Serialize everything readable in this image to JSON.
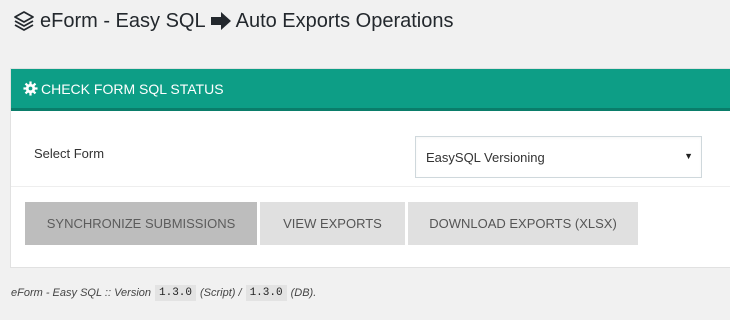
{
  "header": {
    "title_part1": "eForm - Easy SQL",
    "title_part2": "Auto Exports Operations",
    "icons": [
      "layers-icon",
      "arrow-right-icon"
    ]
  },
  "panel": {
    "heading": "CHECK FORM SQL STATUS",
    "heading_icon": "gear-icon",
    "heading_color": "#0d9e86",
    "form": {
      "label": "Select Form",
      "selected_value": "EasySQL Versioning"
    },
    "buttons": {
      "sync": "SYNCHRONIZE SUBMISSIONS",
      "view": "VIEW EXPORTS",
      "download": "DOWNLOAD EXPORTS (XLSX)"
    }
  },
  "footer": {
    "prefix": "eForm - Easy SQL :: Version",
    "script_version": "1.3.0",
    "script_label": "(Script) /",
    "db_version": "1.3.0",
    "db_label": "(DB)."
  }
}
